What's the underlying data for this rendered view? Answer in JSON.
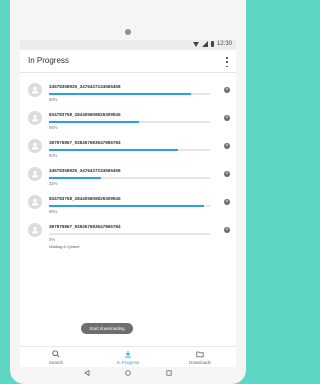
{
  "status": {
    "time": "12:30"
  },
  "appbar": {
    "title": "In Progress"
  },
  "downloads": [
    {
      "name": "34578358925_3476437234565458",
      "percent": 88,
      "percent_label": "88%",
      "status": ""
    },
    {
      "name": "834783758_284405609829309945",
      "percent": 56,
      "percent_label": "56%",
      "status": ""
    },
    {
      "name": "387876867_928457683647866784",
      "percent": 80,
      "percent_label": "80%",
      "status": ""
    },
    {
      "name": "34578358925_3476437234565458",
      "percent": 32,
      "percent_label": "32%",
      "status": ""
    },
    {
      "name": "834783758_284405609829309945",
      "percent": 96,
      "percent_label": "96%",
      "status": ""
    },
    {
      "name": "387876867_928457683647866784",
      "percent": 0,
      "percent_label": "0%",
      "status": "Waiting in Queue"
    }
  ],
  "toast": {
    "text": "Start downloading"
  },
  "bottomnav": {
    "search": "Search",
    "in_progress": "In Progress",
    "downloads": "Downloads"
  },
  "colors": {
    "accent": "#2aa4d7",
    "background": "#5ed6c4"
  }
}
